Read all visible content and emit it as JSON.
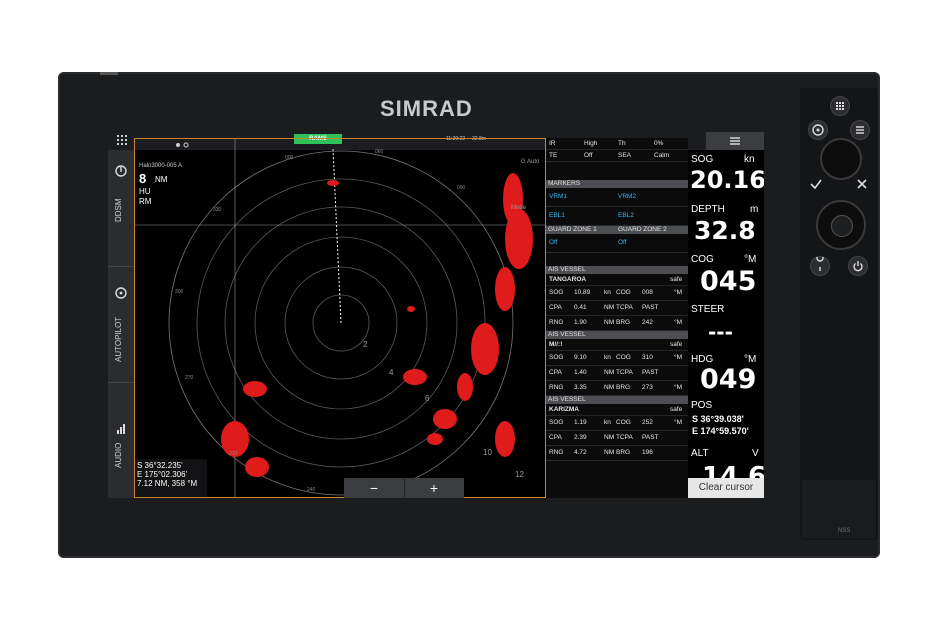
{
  "device": {
    "brand": "SIMRAD",
    "model_label": "NSS"
  },
  "topbar": {
    "status_badge": "RAMS",
    "time": "11:39:22",
    "range_readout": "32.8m"
  },
  "left_sidebar": {
    "items": [
      {
        "label": "DDSM"
      },
      {
        "label": "AUTOPILOT"
      },
      {
        "label": "AUDIO"
      }
    ]
  },
  "radar": {
    "source": "Halo3000-005 A",
    "range": "8",
    "range_unit": "NM",
    "orientation": "HU",
    "motion": "RM",
    "ring_labels": [
      "2",
      "4",
      "6",
      "10",
      "12"
    ],
    "bearing_labels": [
      "000",
      "060",
      "090",
      "120",
      "180",
      "210",
      "240",
      "270",
      "300",
      "330"
    ],
    "gain_label": "G",
    "auto_label": "Auto",
    "mode_label": "Mode",
    "cursor_readout": {
      "lat": "S 36°32.235'",
      "lon": "E 175°02.306'",
      "range_bearing": "7.12 NM, 358 °M"
    },
    "zoom_minus": "−",
    "zoom_plus": "+"
  },
  "side_panel": {
    "top_rows": [
      {
        "c1": "IR",
        "c2": "High",
        "c3": "Th",
        "c4": "0%"
      },
      {
        "c1": "TE",
        "c2": "Off",
        "c3": "SEA",
        "c4": "Calm"
      }
    ],
    "markers_header": "MARKERS",
    "markers": [
      {
        "a": "VRM1",
        "b": "VRM2"
      },
      {
        "a": "EBL1",
        "b": "EBL2"
      }
    ],
    "guard_header_1": "GUARD ZONE 1",
    "guard_header_2": "GUARD ZONE 2",
    "guard_values": {
      "a": "Off",
      "b": "Off"
    },
    "ais_header": "AIS VESSEL",
    "vessels": [
      {
        "name": "TANGAROA",
        "status": "safe",
        "rows": [
          [
            "SOG",
            "10.89",
            "kn",
            "COG",
            "008",
            "°M"
          ],
          [
            "CPA",
            "0.41",
            "NM",
            "TCPA",
            "PAST",
            ""
          ],
          [
            "RNG",
            "1.90",
            "NM",
            "BRG",
            "242",
            "°M"
          ]
        ]
      },
      {
        "name": "M//:!",
        "status": "safe",
        "rows": [
          [
            "SOG",
            "9.10",
            "kn",
            "COG",
            "310",
            "°M"
          ],
          [
            "CPA",
            "1.40",
            "NM",
            "TCPA",
            "PAST",
            ""
          ],
          [
            "RNG",
            "3.35",
            "NM",
            "BRG",
            "273",
            "°M"
          ]
        ]
      },
      {
        "name": "KARIZMA",
        "status": "safe",
        "rows": [
          [
            "SOG",
            "1.19",
            "kn",
            "COG",
            "252",
            "°M"
          ],
          [
            "CPA",
            "2.39",
            "NM",
            "TCPA",
            "PAST",
            ""
          ],
          [
            "RNG",
            "4.72",
            "NM",
            "BRG",
            "196",
            ""
          ]
        ]
      }
    ]
  },
  "data_panel": {
    "sog_label": "SOG",
    "sog_unit": "kn",
    "sog_value": "20.16",
    "depth_label": "DEPTH",
    "depth_unit": "m",
    "depth_value": "32.8",
    "cog_label": "COG",
    "cog_unit": "°M",
    "cog_value": "045",
    "steer_label": "STEER",
    "steer_value": "---",
    "hdg_label": "HDG",
    "hdg_unit": "°M",
    "hdg_value": "049",
    "pos_label": "POS",
    "pos_lat": "S  36°39.038'",
    "pos_lon": "E 174°59.570'",
    "alt_label": "ALT",
    "alt_unit": "V",
    "alt_value": "14.6",
    "clear_cursor": "Clear cursor"
  },
  "colors": {
    "echo": "#e01b1b",
    "accent": "#c8862a",
    "ais_blue": "#38b5f0",
    "status_green": "#2fc15a"
  }
}
